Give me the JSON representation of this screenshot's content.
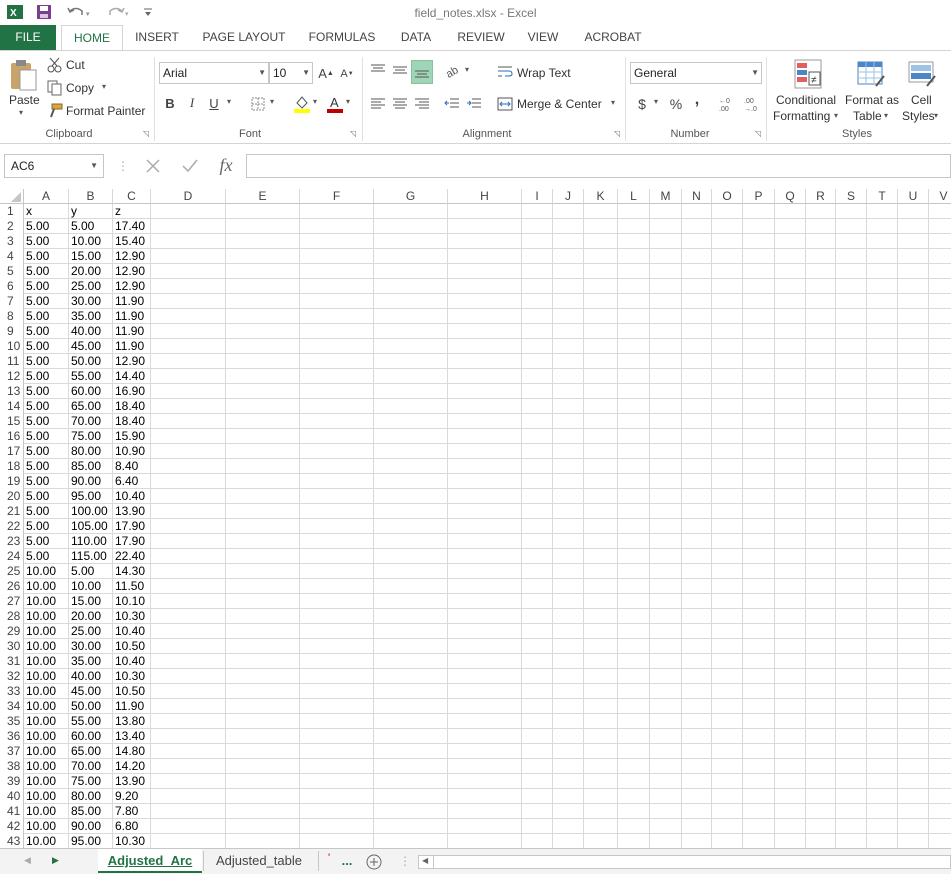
{
  "window": {
    "title": "field_notes.xlsx - Excel"
  },
  "ribbon_tabs": [
    "FILE",
    "HOME",
    "INSERT",
    "PAGE LAYOUT",
    "FORMULAS",
    "DATA",
    "REVIEW",
    "VIEW",
    "ACROBAT"
  ],
  "clipboard": {
    "paste": "Paste",
    "cut": "Cut",
    "copy": "Copy",
    "format_painter": "Format Painter",
    "label": "Clipboard"
  },
  "font": {
    "name": "Arial",
    "size": "10",
    "bold": "B",
    "italic": "I",
    "underline": "U",
    "label": "Font"
  },
  "alignment": {
    "wrap_text": "Wrap Text",
    "merge_center": "Merge & Center",
    "label": "Alignment"
  },
  "number": {
    "format": "General",
    "currency": "$",
    "percent": "%",
    "comma": ",",
    "label": "Number"
  },
  "styles": {
    "conditional_1": "Conditional",
    "conditional_2": "Formatting",
    "format_table_1": "Format as",
    "format_table_2": "Table",
    "cell_styles_1": "Cell",
    "cell_styles_2": "Styles",
    "label": "Styles"
  },
  "formula_bar": {
    "name_box": "AC6",
    "fx": "fx",
    "formula": ""
  },
  "columns": [
    "A",
    "B",
    "C",
    "D",
    "E",
    "F",
    "G",
    "H",
    "I",
    "J",
    "K",
    "L",
    "M",
    "N",
    "O",
    "P",
    "Q",
    "R",
    "S",
    "T",
    "U",
    "V"
  ],
  "rows": [
    [
      "x",
      "y",
      "z"
    ],
    [
      "5.00",
      "5.00",
      "17.40"
    ],
    [
      "5.00",
      "10.00",
      "15.40"
    ],
    [
      "5.00",
      "15.00",
      "12.90"
    ],
    [
      "5.00",
      "20.00",
      "12.90"
    ],
    [
      "5.00",
      "25.00",
      "12.90"
    ],
    [
      "5.00",
      "30.00",
      "11.90"
    ],
    [
      "5.00",
      "35.00",
      "11.90"
    ],
    [
      "5.00",
      "40.00",
      "11.90"
    ],
    [
      "5.00",
      "45.00",
      "11.90"
    ],
    [
      "5.00",
      "50.00",
      "12.90"
    ],
    [
      "5.00",
      "55.00",
      "14.40"
    ],
    [
      "5.00",
      "60.00",
      "16.90"
    ],
    [
      "5.00",
      "65.00",
      "18.40"
    ],
    [
      "5.00",
      "70.00",
      "18.40"
    ],
    [
      "5.00",
      "75.00",
      "15.90"
    ],
    [
      "5.00",
      "80.00",
      "10.90"
    ],
    [
      "5.00",
      "85.00",
      "8.40"
    ],
    [
      "5.00",
      "90.00",
      "6.40"
    ],
    [
      "5.00",
      "95.00",
      "10.40"
    ],
    [
      "5.00",
      "100.00",
      "13.90"
    ],
    [
      "5.00",
      "105.00",
      "17.90"
    ],
    [
      "5.00",
      "110.00",
      "17.90"
    ],
    [
      "5.00",
      "115.00",
      "22.40"
    ],
    [
      "10.00",
      "5.00",
      "14.30"
    ],
    [
      "10.00",
      "10.00",
      "11.50"
    ],
    [
      "10.00",
      "15.00",
      "10.10"
    ],
    [
      "10.00",
      "20.00",
      "10.30"
    ],
    [
      "10.00",
      "25.00",
      "10.40"
    ],
    [
      "10.00",
      "30.00",
      "10.50"
    ],
    [
      "10.00",
      "35.00",
      "10.40"
    ],
    [
      "10.00",
      "40.00",
      "10.30"
    ],
    [
      "10.00",
      "45.00",
      "10.50"
    ],
    [
      "10.00",
      "50.00",
      "11.90"
    ],
    [
      "10.00",
      "55.00",
      "13.80"
    ],
    [
      "10.00",
      "60.00",
      "13.40"
    ],
    [
      "10.00",
      "65.00",
      "14.80"
    ],
    [
      "10.00",
      "70.00",
      "14.20"
    ],
    [
      "10.00",
      "75.00",
      "13.90"
    ],
    [
      "10.00",
      "80.00",
      "9.20"
    ],
    [
      "10.00",
      "85.00",
      "7.80"
    ],
    [
      "10.00",
      "90.00",
      "6.80"
    ],
    [
      "10.00",
      "95.00",
      "10.30"
    ]
  ],
  "sheets": {
    "active": "Adjusted_Arc",
    "other": "Adjusted_table",
    "more": "..."
  },
  "colors": {
    "excel_green": "#217346",
    "font_highlight": "#ffff00",
    "font_color": "#c00000"
  }
}
